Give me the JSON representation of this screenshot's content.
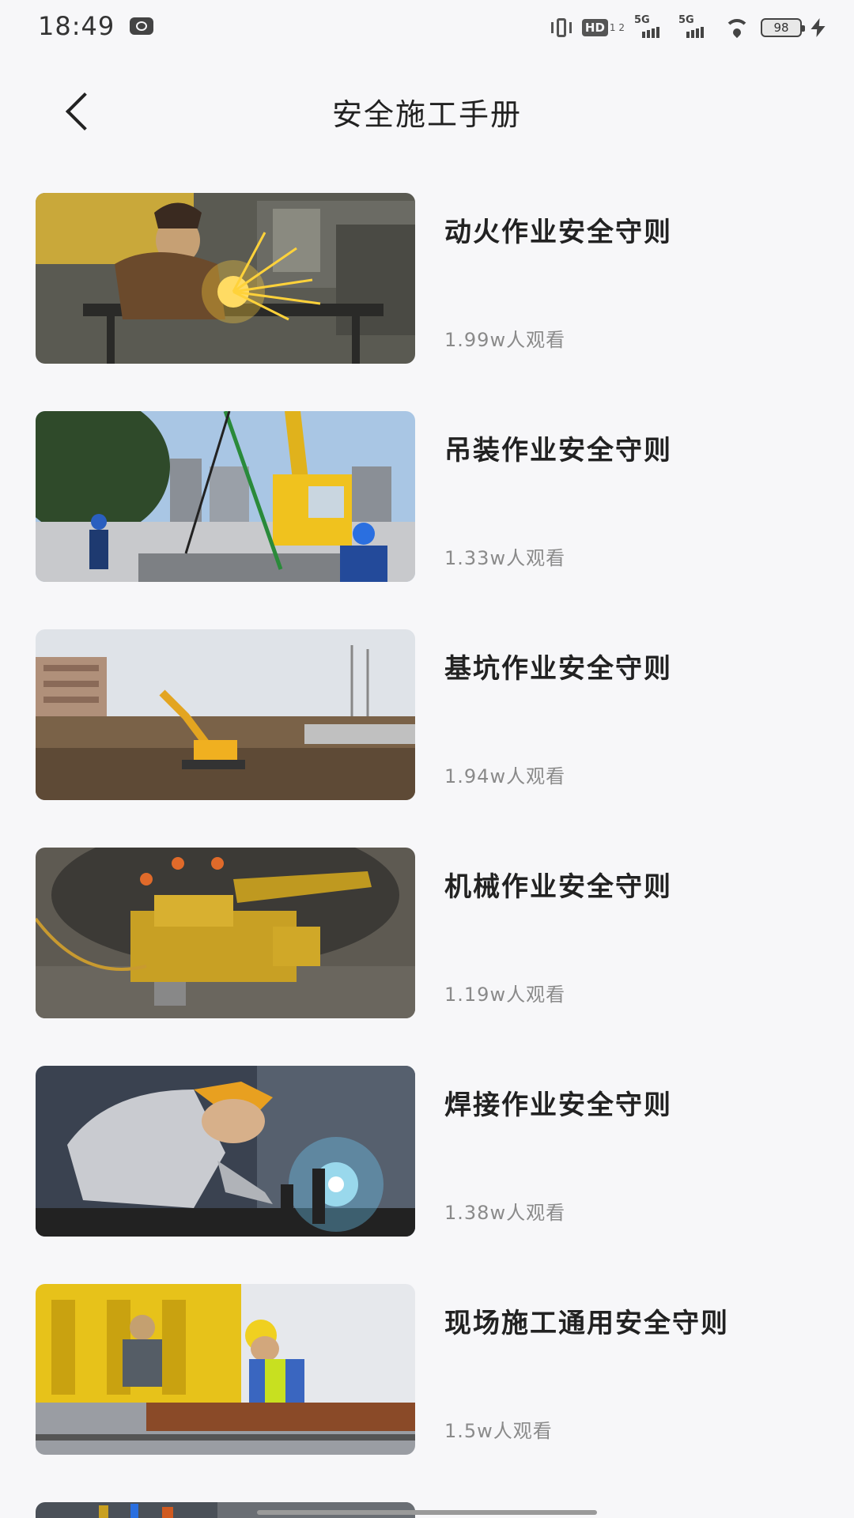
{
  "status_bar": {
    "time": "18:49",
    "hd_label": "HD",
    "hd_sub": "1 2",
    "signal1_label": "5G",
    "signal2_label": "5G",
    "battery": "98"
  },
  "header": {
    "title": "安全施工手册"
  },
  "items": [
    {
      "title": "动火作业安全守则",
      "views": "1.99w人观看",
      "thumb": "hot-work-welding"
    },
    {
      "title": "吊装作业安全守则",
      "views": "1.33w人观看",
      "thumb": "crane-lifting"
    },
    {
      "title": "基坑作业安全守则",
      "views": "1.94w人观看",
      "thumb": "foundation-pit-excavator"
    },
    {
      "title": "机械作业安全守则",
      "views": "1.19w人观看",
      "thumb": "tunnel-drilling-machine"
    },
    {
      "title": "焊接作业安全守则",
      "views": "1.38w人观看",
      "thumb": "welder-sparks"
    },
    {
      "title": "现场施工通用安全守则",
      "views": "1.5w人观看",
      "thumb": "rail-construction-workers"
    }
  ]
}
